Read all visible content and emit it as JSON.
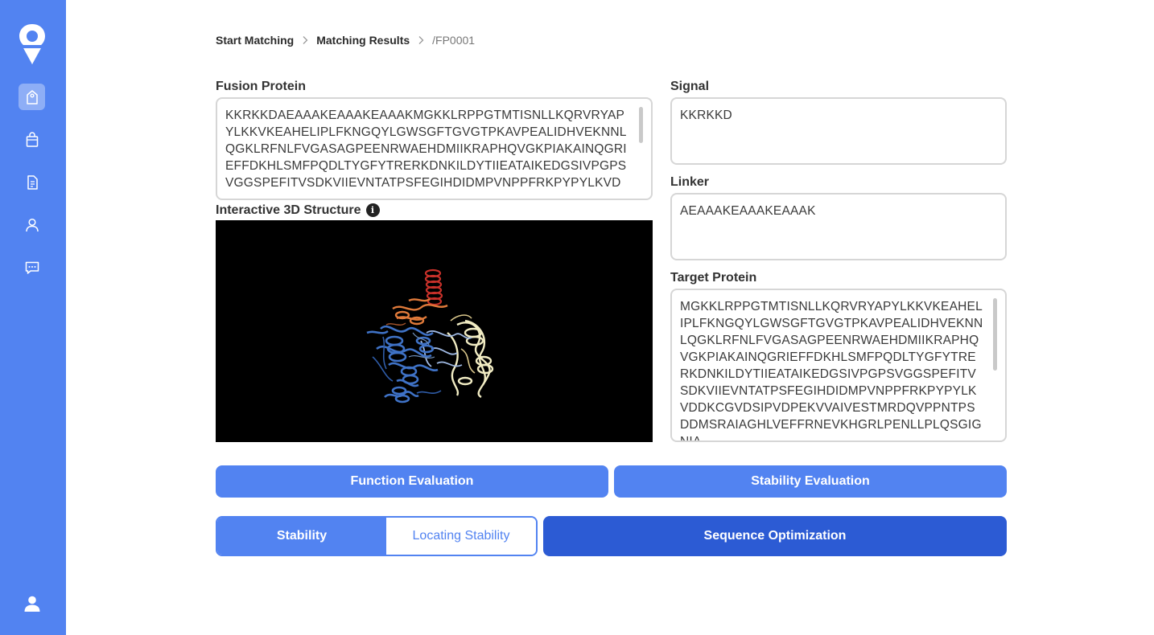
{
  "sidebar": {
    "items": [
      {
        "icon": "tag-icon",
        "active": true
      },
      {
        "icon": "shopping-bag-icon",
        "active": false
      },
      {
        "icon": "document-icon",
        "active": false
      },
      {
        "icon": "user-icon",
        "active": false
      },
      {
        "icon": "chat-icon",
        "active": false
      }
    ],
    "profile_icon": "profile-icon"
  },
  "breadcrumb": {
    "items": [
      "Start Matching",
      "Matching Results"
    ],
    "current": "/FP0001"
  },
  "fusion_protein": {
    "label": "Fusion Protein",
    "value": "KKRKKDAEAAAKEAAAKEAAAKMGKKLRPPGTMTISNLLKQRVRYAPYLKKVKEAHELIPLFKNGQYLGWSGFTGVGTPKAVPEALIDHVEKNNLQGKLRFNLFVGASAGPEENRWAEHDMIIKRAPHQVGKPIAKAINQGRIEFFDKHLSMFPQDLTYGFYTRERKDNKILDYTIIEATAIKEDGSIVPGPSVGGSPEFITVSDKVIIEVNTATPSFEGIHDIDMPVNPPFRKPYPYLKVD"
  },
  "structure": {
    "label": "Interactive 3D Structure",
    "info_icon": "info-icon"
  },
  "signal": {
    "label": "Signal",
    "value": "KKRKKD"
  },
  "linker": {
    "label": "Linker",
    "value": "AEAAAKEAAAKEAAAK"
  },
  "target_protein": {
    "label": "Target Protein",
    "value": "MGKKLRPPGTMTISNLLKQRVRYAPYLKKVKEAHELIPLFKNGQYLGWSGFTGVGTPKAVPEALIDHVEKNNLQGKLRFNLFVGASAGPEENRWAEHDMIIKRAPHQVGKPIAKAINQGRIEFFDKHLSMFPQDLTYGFYTRERKDNKILDYTIIEATAIKEDGSIVPGPSVGGSPEFITVSDKVIIEVNTATPSFEGIHDIDMPVNPPFRKPYPYLKVDDKCGVDSIPVDPEKVVAIVESTMRDQVPPNTPSDDMSRAIAGHLVEFFRNEVKHGRLPENLLPLQSGIGNIA"
  },
  "actions": {
    "function_evaluation": "Function Evaluation",
    "stability_evaluation": "Stability Evaluation",
    "stability": "Stability",
    "locating_stability": "Locating Stability",
    "sequence_optimization": "Sequence Optimization"
  },
  "colors": {
    "primary": "#5283f1",
    "primary_dark": "#2c5bd4",
    "border": "#d6d6d6"
  }
}
